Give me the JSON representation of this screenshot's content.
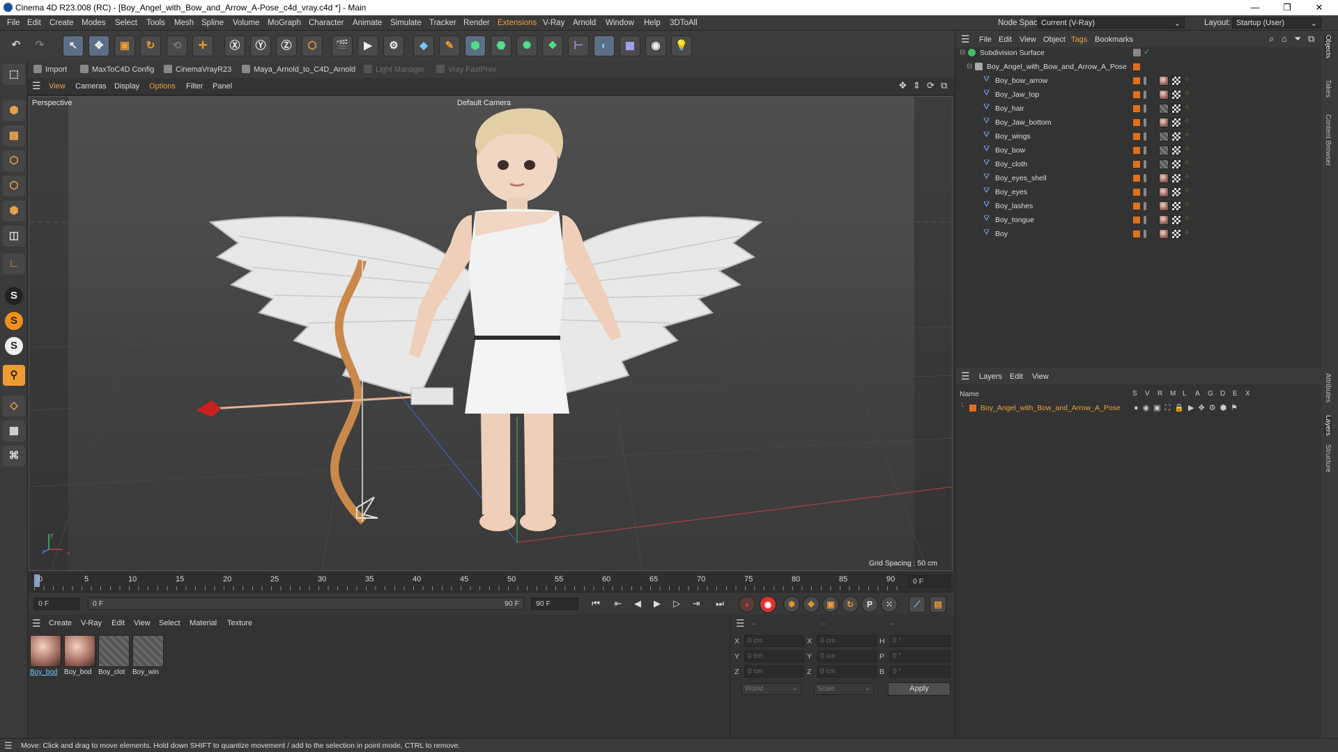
{
  "window": {
    "title": "Cinema 4D R23.008 (RC) - [Boy_Angel_with_Bow_and_Arrow_A-Pose_c4d_vray.c4d *] - Main",
    "minimize": "—",
    "restore": "❐",
    "close": "✕"
  },
  "menubar": {
    "items": [
      "File",
      "Edit",
      "Create",
      "Modes",
      "Select",
      "Tools",
      "Mesh",
      "Spline",
      "Volume",
      "MoGraph",
      "Character",
      "Animate",
      "Simulate",
      "Tracker",
      "Render",
      "Extensions",
      "V-Ray",
      "Arnold",
      "Window",
      "Help",
      "3DToAll"
    ],
    "node_space_label": "Node Space:",
    "node_space_value": "Current (V-Ray)",
    "layout_label": "Layout:",
    "layout_value": "Startup (User)"
  },
  "plugins": {
    "items": [
      "Import",
      "MaxToC4D Config",
      "CinemaVrayR23",
      "Maya_Arnold_to_C4D_Arnold",
      "Light Manager",
      "Vray FastPrev"
    ]
  },
  "viewport": {
    "menu": [
      "View",
      "Cameras",
      "Display",
      "Options",
      "Filter",
      "Panel"
    ],
    "label": "Perspective",
    "camera": "Default Camera",
    "grid_spacing": "Grid Spacing : 50 cm",
    "axis": {
      "y": "y",
      "z": "z",
      "x": "x"
    }
  },
  "timeline": {
    "ticks": [
      "0",
      "5",
      "10",
      "15",
      "20",
      "25",
      "30",
      "35",
      "40",
      "45",
      "50",
      "55",
      "60",
      "65",
      "70",
      "75",
      "80",
      "85",
      "90"
    ],
    "frame_right": "0 F",
    "current_frame": "0 F",
    "range_start": "0 F",
    "range_end": "90 F",
    "end_field": "90 F"
  },
  "materials": {
    "menu": [
      "Create",
      "V-Ray",
      "Edit",
      "View",
      "Select",
      "Material",
      "Texture"
    ],
    "items": [
      "Boy_bod",
      "Boy_bod",
      "Boy_clot",
      "Boy_win"
    ]
  },
  "coords": {
    "headers": [
      "--",
      "--",
      "--"
    ],
    "rows": [
      {
        "a": "X",
        "v1": "0 cm",
        "b": "X",
        "v2": "0 cm",
        "c": "H",
        "v3": "0 °"
      },
      {
        "a": "Y",
        "v1": "0 cm",
        "b": "Y",
        "v2": "0 cm",
        "c": "P",
        "v3": "0 °"
      },
      {
        "a": "Z",
        "v1": "0 cm",
        "b": "Z",
        "v2": "0 cm",
        "c": "B",
        "v3": "0 °"
      }
    ],
    "world": "World",
    "scale": "Scale",
    "apply": "Apply"
  },
  "object_manager": {
    "menu": [
      "File",
      "Edit",
      "View",
      "Object",
      "Tags",
      "Bookmarks"
    ],
    "root": "Subdivision Surface",
    "group": "Boy_Angel_with_Bow_and_Arrow_A_Pose",
    "children": [
      "Boy_bow_arrow",
      "Boy_Jaw_top",
      "Boy_hair",
      "Boy_Jaw_bottom",
      "Boy_wings",
      "Boy_bow",
      "Boy_cloth",
      "Boy_eyes_shell",
      "Boy_eyes",
      "Boy_lashes",
      "Boy_tongue",
      "Boy"
    ]
  },
  "layer_manager": {
    "menu": [
      "Layers",
      "Edit",
      "View"
    ],
    "name_header": "Name",
    "flags": [
      "S",
      "V",
      "R",
      "M",
      "L",
      "A",
      "G",
      "D",
      "E",
      "X"
    ],
    "layer": "Boy_Angel_with_Bow_and_Arrow_A_Pose"
  },
  "side_tabs": [
    "Objects",
    "Takes",
    "Content Browser",
    "Attributes",
    "Layers",
    "Structure"
  ],
  "status": "Move: Click and drag to move elements. Hold down SHIFT to quantize movement / add to the selection in point mode, CTRL to remove.",
  "colors": {
    "accent": "#f0a040",
    "layer": "#e0701c",
    "bg": "#333333"
  }
}
